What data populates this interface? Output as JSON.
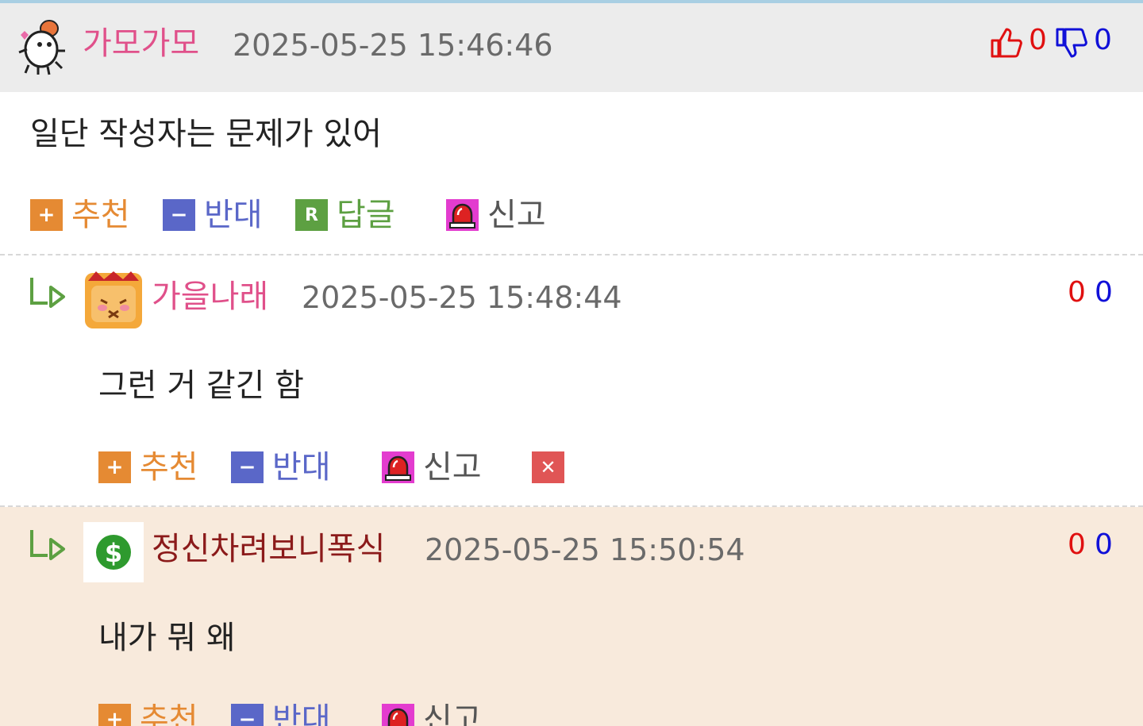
{
  "labels": {
    "recommend": "추천",
    "oppose": "반대",
    "reply": "답글",
    "report": "신고"
  },
  "comments": [
    {
      "nick": "가모가모",
      "time": "2025-05-25 15:46:46",
      "up": "0",
      "down": "0",
      "content": "일단 작성자는 문제가 있어",
      "avatar": "hamster-heart-icon"
    },
    {
      "nick": "가을나래",
      "time": "2025-05-25 15:48:44",
      "up": "0",
      "down": "0",
      "content": "그런 거 같긴 함",
      "avatar": "hamster-flower-icon"
    },
    {
      "nick": "정신차려보니폭식",
      "time": "2025-05-25 15:50:54",
      "up": "0",
      "down": "0",
      "content": "내가 뭐 왜",
      "avatar": "dollar-coin-icon"
    }
  ],
  "colors": {
    "header_bg": "#ececec",
    "highlight_bg": "#f8eadc",
    "nick_pink": "#e0508a",
    "nick_dark_red": "#8b1a1a",
    "recommend": "#e58a33",
    "oppose": "#5a67c8",
    "reply": "#5da042"
  }
}
